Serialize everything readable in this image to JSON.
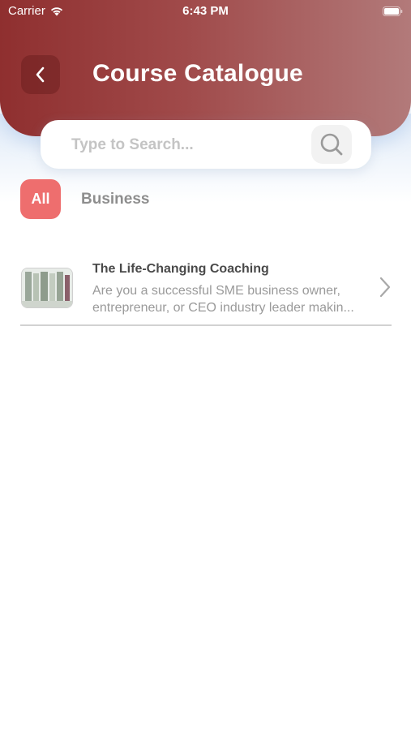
{
  "status_bar": {
    "carrier": "Carrier",
    "time": "6:43 PM"
  },
  "header": {
    "title": "Course Catalogue",
    "back_icon": "chevron-left-icon",
    "gradient_start": "#8f2f2f",
    "gradient_end": "#b27a7a"
  },
  "search": {
    "placeholder": "Type to Search...",
    "value": "",
    "icon": "search-icon"
  },
  "categories": {
    "items": [
      {
        "label": "All",
        "selected": true
      },
      {
        "label": "Business",
        "selected": false
      }
    ],
    "accent": "#ee6e6e"
  },
  "courses": [
    {
      "title": "The Life-Changing Coaching",
      "description_line1": "Are you a successful SME business owner,",
      "description_line2": "entrepreneur, or CEO industry leader makin...",
      "chevron_icon": "chevron-right-icon"
    }
  ]
}
